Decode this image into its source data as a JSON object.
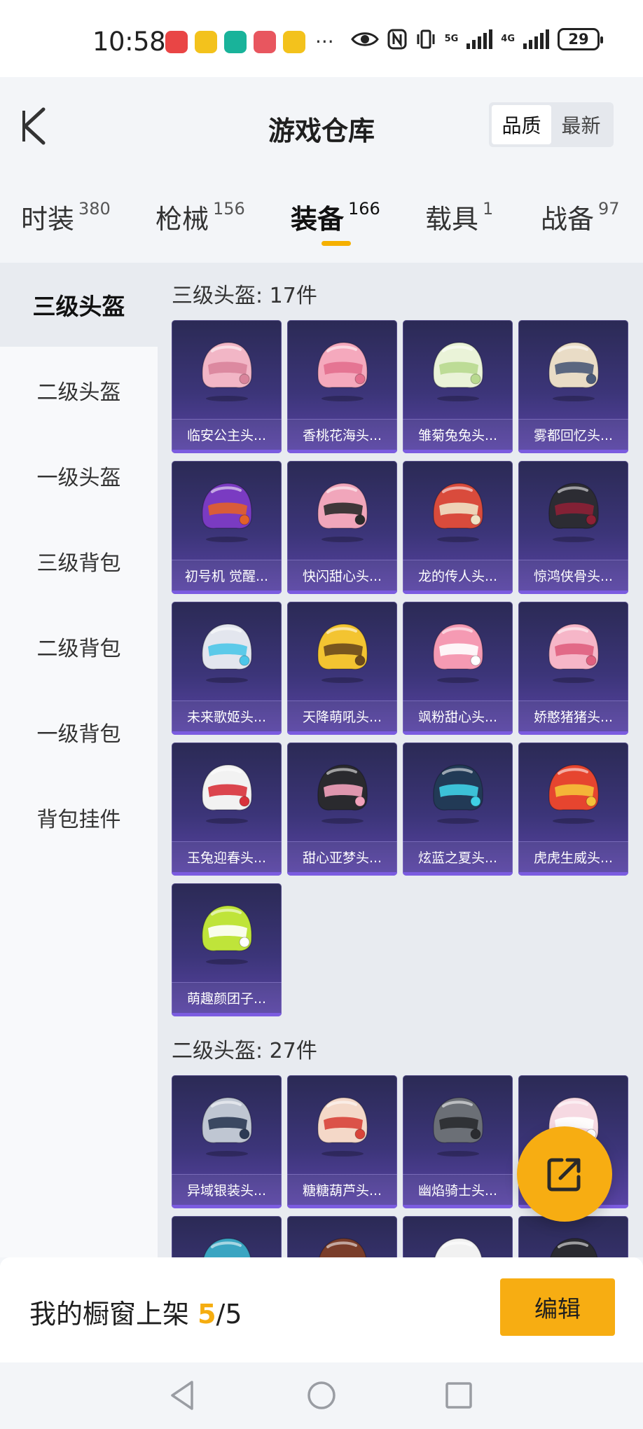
{
  "status_bar": {
    "time": "10:58",
    "more": "···",
    "network1": "5G",
    "network2": "4G",
    "battery": "29",
    "app_icon_colors": [
      "#e94545",
      "#f3c21c",
      "#19b39a",
      "#e8565f",
      "#f3c21c"
    ],
    "icons": [
      "eye-icon",
      "nfc-icon",
      "vibrate-icon",
      "signal-icon",
      "battery-icon"
    ]
  },
  "header": {
    "title": "游戏仓库",
    "sort_options": [
      "品质",
      "最新"
    ],
    "active_sort": "品质"
  },
  "tabs": [
    {
      "label": "时装",
      "count": "380"
    },
    {
      "label": "枪械",
      "count": "156"
    },
    {
      "label": "装备",
      "count": "166",
      "active": true
    },
    {
      "label": "载具",
      "count": "1"
    },
    {
      "label": "战备",
      "count": "97"
    }
  ],
  "sidebar": {
    "items": [
      "三级头盔",
      "二级头盔",
      "一级头盔",
      "三级背包",
      "二级背包",
      "一级背包",
      "背包挂件"
    ],
    "active": "三级头盔"
  },
  "sections": [
    {
      "title": "三级头盔: 17件",
      "items": [
        {
          "name": "临安公主头...",
          "color": "#f2b6c6",
          "accent": "#d9849b"
        },
        {
          "name": "香桃花海头...",
          "color": "#f5a9bd",
          "accent": "#e36f8e"
        },
        {
          "name": "雏菊兔兔头...",
          "color": "#eaf3d8",
          "accent": "#b8d98f"
        },
        {
          "name": "雾都回忆头...",
          "color": "#e9dcc6",
          "accent": "#4b5a78"
        },
        {
          "name": "初号机 觉醒...",
          "color": "#7a3bc2",
          "accent": "#e2612a"
        },
        {
          "name": "快闪甜心头...",
          "color": "#f1a6bb",
          "accent": "#2b2b2b"
        },
        {
          "name": "龙的传人头...",
          "color": "#d94b3c",
          "accent": "#f0e2c4"
        },
        {
          "name": "惊鸿侠骨头...",
          "color": "#2c2c33",
          "accent": "#8d2035"
        },
        {
          "name": "未来歌姬头...",
          "color": "#e3e6ee",
          "accent": "#4dc6e8"
        },
        {
          "name": "天降萌吼头...",
          "color": "#f3c431",
          "accent": "#6b4a1d"
        },
        {
          "name": "飒粉甜心头...",
          "color": "#f59ab3",
          "accent": "#ffffff"
        },
        {
          "name": "娇憨猪猪头...",
          "color": "#f6b6c8",
          "accent": "#e0607f"
        },
        {
          "name": "玉兔迎春头...",
          "color": "#f2f2f2",
          "accent": "#d8323b"
        },
        {
          "name": "甜心亚梦头...",
          "color": "#2a2a2e",
          "accent": "#f2a2bc"
        },
        {
          "name": "炫蓝之夏头...",
          "color": "#223a56",
          "accent": "#3fd0e6"
        },
        {
          "name": "虎虎生威头...",
          "color": "#e6452f",
          "accent": "#f5c13a"
        },
        {
          "name": "萌趣颜团子...",
          "color": "#bfe43a",
          "accent": "#ffffff"
        }
      ]
    },
    {
      "title": "二级头盔: 27件",
      "items": [
        {
          "name": "异域银装头...",
          "color": "#bfc6d2",
          "accent": "#2c3a54"
        },
        {
          "name": "糖糖葫芦头...",
          "color": "#f4d8c8",
          "accent": "#d8443a"
        },
        {
          "name": "幽焰骑士头...",
          "color": "#6b6f76",
          "accent": "#2a2b30"
        },
        {
          "name": "",
          "color": "#f6d9e2",
          "accent": "#ffffff"
        },
        {
          "name": "",
          "color": "#3aa5c2",
          "accent": "#1c2f3f"
        },
        {
          "name": "",
          "color": "#7a3d2a",
          "accent": "#e2b44b"
        },
        {
          "name": "",
          "color": "#f1f1f1",
          "accent": "#cccccc"
        },
        {
          "name": "",
          "color": "#2a2a30",
          "accent": "#f0d53a"
        }
      ]
    }
  ],
  "fab_icon": "share-icon",
  "bottom_bar": {
    "prefix": "我的橱窗上架 ",
    "count": "5",
    "suffix": "/5",
    "button": "编辑"
  },
  "nav": [
    "back-nav-icon",
    "home-nav-icon",
    "recents-nav-icon"
  ],
  "colors": {
    "accent": "#f7ad12",
    "card_bg": "#3c3579",
    "card_edge": "#7b5ce0"
  }
}
